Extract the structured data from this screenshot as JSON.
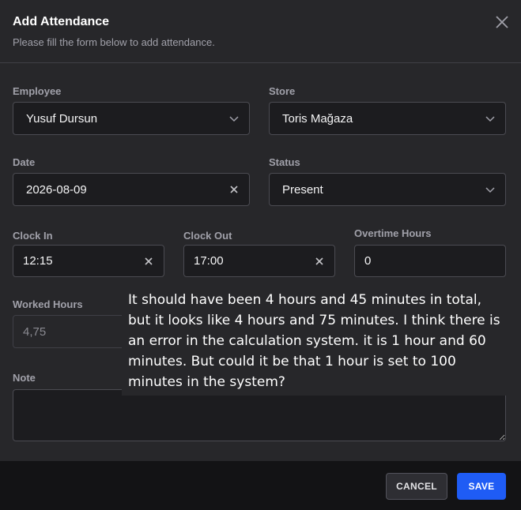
{
  "dialog": {
    "title": "Add Attendance",
    "subtitle": "Please fill the form below to add attendance.",
    "close_icon": "close-icon"
  },
  "form": {
    "employee": {
      "label": "Employee",
      "value": "Yusuf Dursun"
    },
    "store": {
      "label": "Store",
      "value": "Toris Mağaza"
    },
    "date": {
      "label": "Date",
      "value": "2026-08-09"
    },
    "status": {
      "label": "Status",
      "value": "Present"
    },
    "clock_in": {
      "label": "Clock In",
      "value": "12:15"
    },
    "clock_out": {
      "label": "Clock Out",
      "value": "17:00"
    },
    "overtime_hours": {
      "label": "Overtime Hours",
      "value": "0"
    },
    "worked_hours": {
      "label": "Worked Hours",
      "value": "4,75"
    },
    "note": {
      "label": "Note",
      "value": ""
    }
  },
  "footer": {
    "cancel_label": "CANCEL",
    "save_label": "SAVE"
  },
  "annotation": {
    "lines": [
      "It should have been 4 hours and 45 minutes in total,",
      "but it looks like 4 hours and 75 minutes. I think there is",
      "an error in the calculation system. it is 1 hour and 60",
      "minutes. But could it be that 1 hour is set to 100",
      "minutes in the system?"
    ]
  },
  "colors": {
    "background": "#27272a",
    "input_background": "#1c1c1f",
    "primary": "#1f5cf5",
    "footer": "#131315"
  }
}
